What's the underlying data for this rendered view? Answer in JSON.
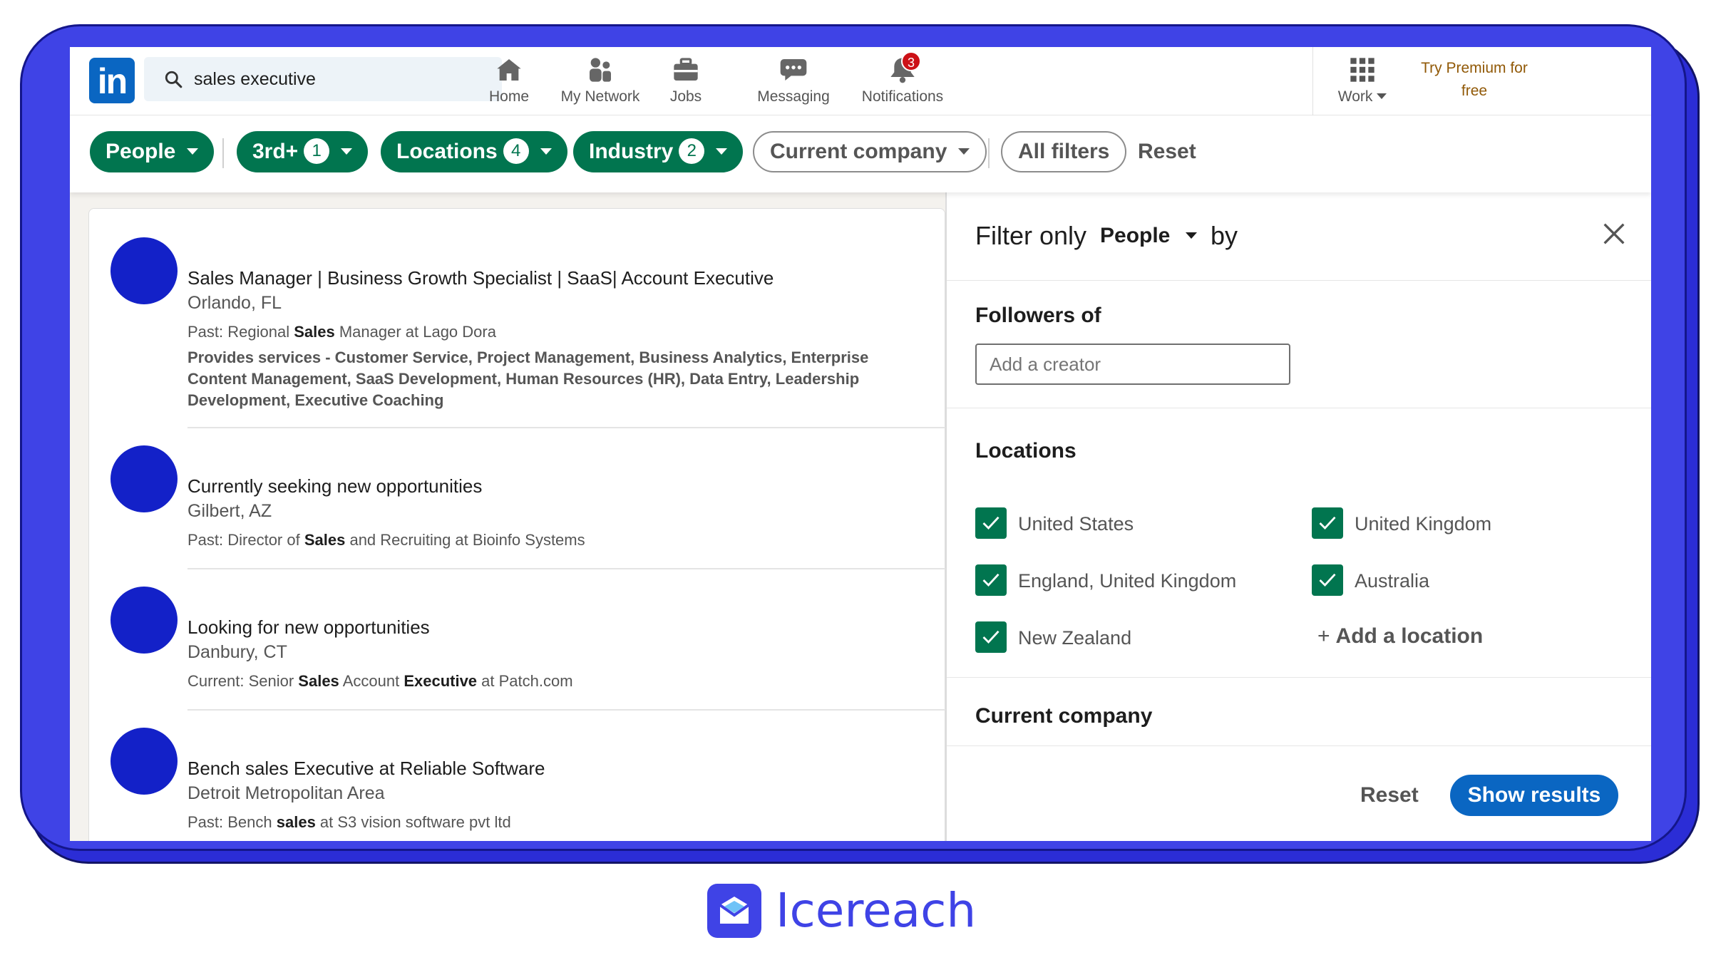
{
  "colors": {
    "frame": "#3f43e6",
    "linkedin_blue": "#0a66c2",
    "green": "#01754f",
    "avatar": "#1321c8",
    "premium": "#915907",
    "badge": "#cc1016"
  },
  "nav": {
    "logo_text": "in",
    "search_value": "sales executive",
    "items": [
      {
        "label": "Home",
        "icon": "home-icon"
      },
      {
        "label": "My Network",
        "icon": "network-icon"
      },
      {
        "label": "Jobs",
        "icon": "briefcase-icon"
      },
      {
        "label": "Messaging",
        "icon": "messaging-icon"
      },
      {
        "label": "Notifications",
        "icon": "bell-icon",
        "badge": "3"
      }
    ],
    "work_label": "Work",
    "premium_line1": "Try Premium for",
    "premium_line2": "free"
  },
  "filters": {
    "people": "People",
    "connections": "3rd+",
    "connections_count": "1",
    "locations": "Locations",
    "locations_count": "4",
    "industry": "Industry",
    "industry_count": "2",
    "current_company": "Current company",
    "all_filters": "All filters",
    "reset": "Reset"
  },
  "results": [
    {
      "title": "Sales Manager | Business Growth Specialist | SaaS| Account Executive",
      "location": "Orlando, FL",
      "line_prefix": "Past: Regional ",
      "line_bold": "Sales",
      "line_suffix": " Manager at Lago Dora",
      "services": "Provides services - Customer Service, Project Management, Business Analytics, Enterprise Content Management, SaaS Development, Human Resources (HR), Data Entry, Leadership Development, Executive Coaching"
    },
    {
      "title": "Currently seeking new opportunities",
      "location": "Gilbert, AZ",
      "line_prefix": "Past: Director of ",
      "line_bold": "Sales",
      "line_suffix": " and Recruiting at Bioinfo Systems"
    },
    {
      "title": "Looking for new opportunities",
      "location": "Danbury, CT",
      "line_prefix": "Current: Senior ",
      "line_bold": "Sales",
      "line_mid": " Account ",
      "line_bold2": "Executive",
      "line_suffix": " at Patch.com"
    },
    {
      "title": "Bench sales Executive at Reliable Software",
      "location": "Detroit Metropolitan Area",
      "line_prefix": "Past: Bench ",
      "line_bold": "sales",
      "line_suffix": " at S3 vision software pvt ltd"
    }
  ],
  "panel": {
    "filter_only": "Filter only",
    "selected_type": "People",
    "by": "by",
    "followers_title": "Followers of",
    "creator_placeholder": "Add a creator",
    "locations_title": "Locations",
    "locations": [
      {
        "label": "United States",
        "checked": true
      },
      {
        "label": "United Kingdom",
        "checked": true
      },
      {
        "label": "England, United Kingdom",
        "checked": true
      },
      {
        "label": "Australia",
        "checked": true
      },
      {
        "label": "New Zealand",
        "checked": true
      }
    ],
    "add_location": "Add a location",
    "current_company_title": "Current company",
    "reset": "Reset",
    "show_results": "Show results"
  },
  "brand": {
    "name": "Icereach"
  }
}
